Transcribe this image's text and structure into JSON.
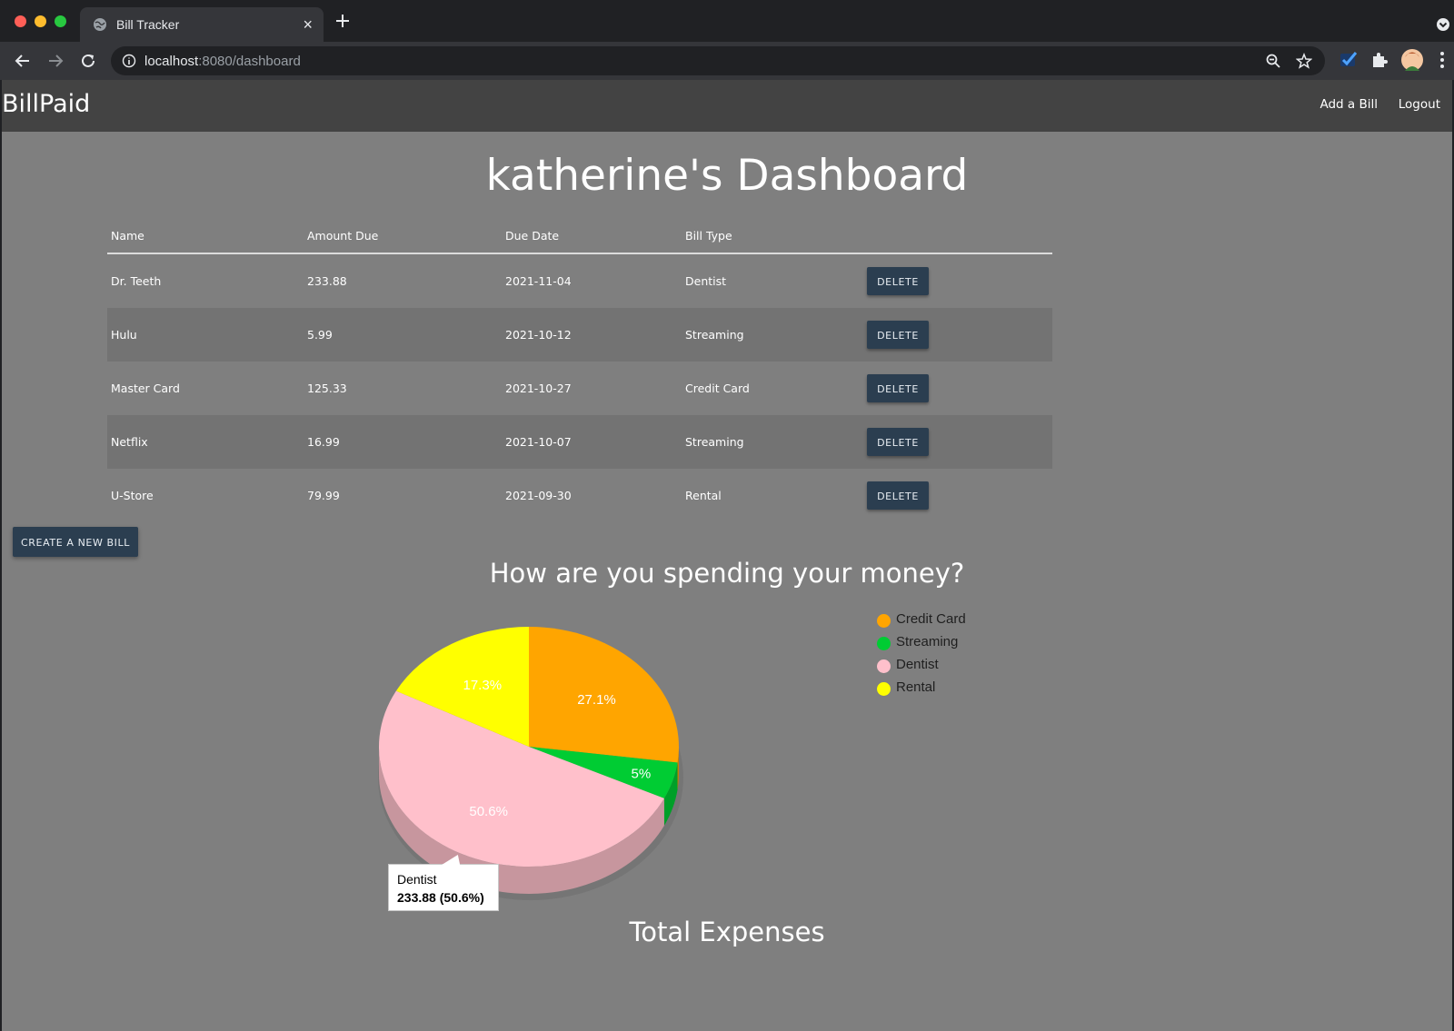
{
  "browser": {
    "tab_title": "Bill Tracker",
    "url_host": "localhost",
    "url_rest": ":8080/dashboard"
  },
  "navbar": {
    "brand": "BillPaid",
    "add_bill": "Add a Bill",
    "logout": "Logout"
  },
  "dashboard": {
    "title": "katherine's Dashboard",
    "columns": [
      "Name",
      "Amount Due",
      "Due Date",
      "Bill Type"
    ],
    "delete_label": "DELETE",
    "bills": [
      {
        "name": "Dr. Teeth",
        "amount": "233.88",
        "due": "2021-11-04",
        "type": "Dentist"
      },
      {
        "name": "Hulu",
        "amount": "5.99",
        "due": "2021-10-12",
        "type": "Streaming"
      },
      {
        "name": "Master Card",
        "amount": "125.33",
        "due": "2021-10-27",
        "type": "Credit Card"
      },
      {
        "name": "Netflix",
        "amount": "16.99",
        "due": "2021-10-07",
        "type": "Streaming"
      },
      {
        "name": "U-Store",
        "amount": "79.99",
        "due": "2021-09-30",
        "type": "Rental"
      }
    ],
    "create_label": "CREATE A NEW BILL"
  },
  "chart": {
    "title": "How are you spending your money?",
    "total_title": "Total Expenses",
    "tooltip": {
      "label": "Dentist",
      "value": "233.88 (50.6%)"
    }
  },
  "chart_data": {
    "type": "pie",
    "title": "How are you spending your money?",
    "legend_position": "right",
    "slices": [
      {
        "label": "Credit Card",
        "value": 125.33,
        "percent_label": "27.1%",
        "color": "#ffa500"
      },
      {
        "label": "Streaming",
        "value": 22.98,
        "percent_label": "5%",
        "color": "#00cc33"
      },
      {
        "label": "Dentist",
        "value": 233.88,
        "percent_label": "50.6%",
        "color": "#ffc0cb"
      },
      {
        "label": "Rental",
        "value": 79.99,
        "percent_label": "17.3%",
        "color": "#ffff00"
      }
    ]
  }
}
